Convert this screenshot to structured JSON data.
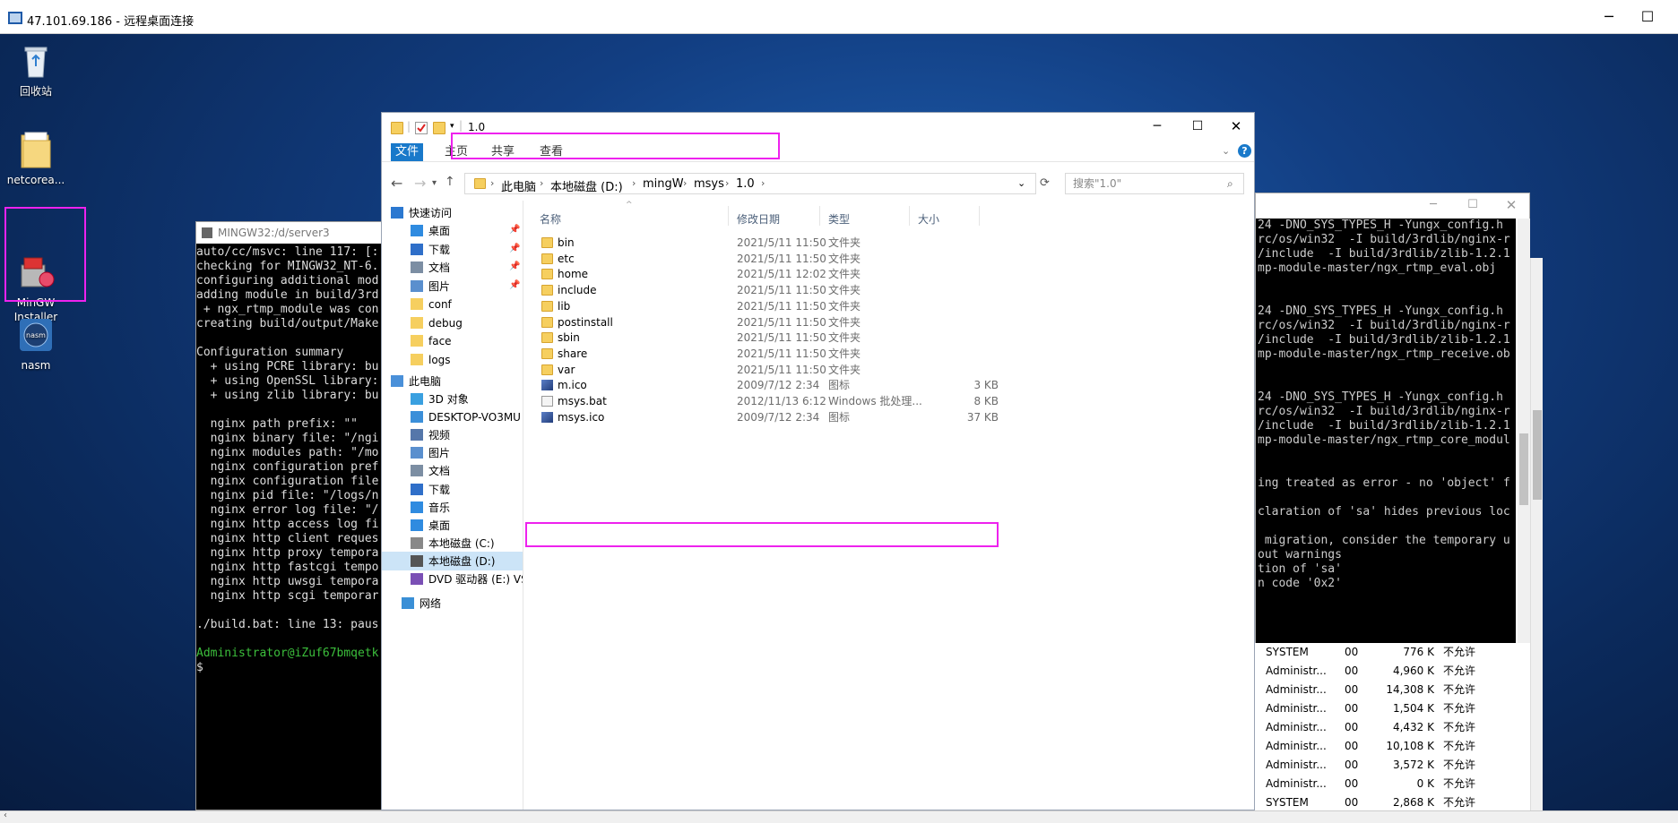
{
  "rdp": {
    "title": "47.101.69.186 - 远程桌面连接"
  },
  "desktop_icons": [
    {
      "label": "回收站"
    },
    {
      "label": "netcorea..."
    },
    {
      "label": "MinGW\nInstaller"
    },
    {
      "label": "nasm"
    }
  ],
  "terminal": {
    "title": "MINGW32:/d/server3",
    "lines": [
      "auto/cc/msvc: line 117: [:",
      "checking for MINGW32_NT-6.",
      "configuring additional mod",
      "adding module in build/3rd",
      " + ngx_rtmp_module was con",
      "creating build/output/Make",
      "",
      "Configuration summary",
      "  + using PCRE library: bu",
      "  + using OpenSSL library:",
      "  + using zlib library: bu",
      "",
      "  nginx path prefix: \"\"",
      "  nginx binary file: \"/ngi",
      "  nginx modules path: \"/mo",
      "  nginx configuration pref",
      "  nginx configuration file",
      "  nginx pid file: \"/logs/n",
      "  nginx error log file: \"/",
      "  nginx http access log fi",
      "  nginx http client reques",
      "  nginx http proxy tempora",
      "  nginx http fastcgi tempo",
      "  nginx http uwsgi tempora",
      "  nginx http scgi temporar",
      "",
      "./build.bat: line 13: paus",
      "",
      "Administrator@iZuf67bmqetk",
      "$"
    ]
  },
  "console": {
    "lines": [
      "24 -DNO_SYS_TYPES_H -Yungx_config.h",
      "rc/os/win32  -I build/3rdlib/nginx-r",
      "/include  -I build/3rdlib/zlib-1.2.1",
      "mp-module-master/ngx_rtmp_eval.obj",
      "",
      "",
      "24 -DNO_SYS_TYPES_H -Yungx_config.h",
      "rc/os/win32  -I build/3rdlib/nginx-r",
      "/include  -I build/3rdlib/zlib-1.2.1",
      "mp-module-master/ngx_rtmp_receive.ob",
      "",
      "",
      "24 -DNO_SYS_TYPES_H -Yungx_config.h",
      "rc/os/win32  -I build/3rdlib/nginx-r",
      "/include  -I build/3rdlib/zlib-1.2.1",
      "mp-module-master/ngx_rtmp_core_modul",
      "",
      "",
      "ing treated as error - no 'object' f",
      "",
      "claration of 'sa' hides previous loc",
      "",
      " migration, consider the temporary u",
      "out warnings",
      "tion of 'sa'",
      "n code '0x2'"
    ]
  },
  "tasks": [
    {
      "user": "SYSTEM",
      "sess": "00",
      "mem": "776 K",
      "status": "不允许"
    },
    {
      "user": "Administr...",
      "sess": "00",
      "mem": "4,960 K",
      "status": "不允许"
    },
    {
      "user": "Administr...",
      "sess": "00",
      "mem": "14,308 K",
      "status": "不允许"
    },
    {
      "user": "Administr...",
      "sess": "00",
      "mem": "1,504 K",
      "status": "不允许"
    },
    {
      "user": "Administr...",
      "sess": "00",
      "mem": "4,432 K",
      "status": "不允许"
    },
    {
      "user": "Administr...",
      "sess": "00",
      "mem": "10,108 K",
      "status": "不允许"
    },
    {
      "user": "Administr...",
      "sess": "00",
      "mem": "3,572 K",
      "status": "不允许"
    },
    {
      "user": "Administr...",
      "sess": "00",
      "mem": "0 K",
      "status": "不允许"
    },
    {
      "user": "SYSTEM",
      "sess": "00",
      "mem": "2,868 K",
      "status": "不允许"
    }
  ],
  "explorer": {
    "title": "1.0",
    "tabs": {
      "file": "文件",
      "home": "主页",
      "share": "共享",
      "view": "查看"
    },
    "breadcrumb": [
      "此电脑",
      "本地磁盘 (D:)",
      "mingW",
      "msys",
      "1.0"
    ],
    "search_placeholder": "搜索\"1.0\"",
    "nav": {
      "quick_access": "快速访问",
      "quick_items": [
        "桌面",
        "下载",
        "文档",
        "图片"
      ],
      "folders": [
        "conf",
        "debug",
        "face",
        "logs"
      ],
      "this_pc": "此电脑",
      "pc_items": [
        "3D 对象",
        "DESKTOP-VO3MU",
        "视频",
        "图片",
        "文档",
        "下载",
        "音乐",
        "桌面",
        "本地磁盘 (C:)",
        "本地磁盘 (D:)",
        "DVD 驱动器 (E:) VS"
      ],
      "network": "网络"
    },
    "columns": {
      "name": "名称",
      "date": "修改日期",
      "type": "类型",
      "size": "大小"
    },
    "files": [
      {
        "name": "bin",
        "date": "2021/5/11 11:50",
        "type": "文件夹",
        "size": "",
        "kind": "folder"
      },
      {
        "name": "etc",
        "date": "2021/5/11 11:50",
        "type": "文件夹",
        "size": "",
        "kind": "folder"
      },
      {
        "name": "home",
        "date": "2021/5/11 12:02",
        "type": "文件夹",
        "size": "",
        "kind": "folder"
      },
      {
        "name": "include",
        "date": "2021/5/11 11:50",
        "type": "文件夹",
        "size": "",
        "kind": "folder"
      },
      {
        "name": "lib",
        "date": "2021/5/11 11:50",
        "type": "文件夹",
        "size": "",
        "kind": "folder"
      },
      {
        "name": "postinstall",
        "date": "2021/5/11 11:50",
        "type": "文件夹",
        "size": "",
        "kind": "folder"
      },
      {
        "name": "sbin",
        "date": "2021/5/11 11:50",
        "type": "文件夹",
        "size": "",
        "kind": "folder"
      },
      {
        "name": "share",
        "date": "2021/5/11 11:50",
        "type": "文件夹",
        "size": "",
        "kind": "folder"
      },
      {
        "name": "var",
        "date": "2021/5/11 11:50",
        "type": "文件夹",
        "size": "",
        "kind": "folder"
      },
      {
        "name": "m.ico",
        "date": "2009/7/12 2:34",
        "type": "图标",
        "size": "3 KB",
        "kind": "ico"
      },
      {
        "name": "msys.bat",
        "date": "2012/11/13 6:12",
        "type": "Windows 批处理...",
        "size": "8 KB",
        "kind": "bat"
      },
      {
        "name": "msys.ico",
        "date": "2009/7/12 2:34",
        "type": "图标",
        "size": "37 KB",
        "kind": "ico"
      }
    ]
  },
  "colors": {
    "highlight": "#ee22ee",
    "accent": "#1979ca"
  }
}
